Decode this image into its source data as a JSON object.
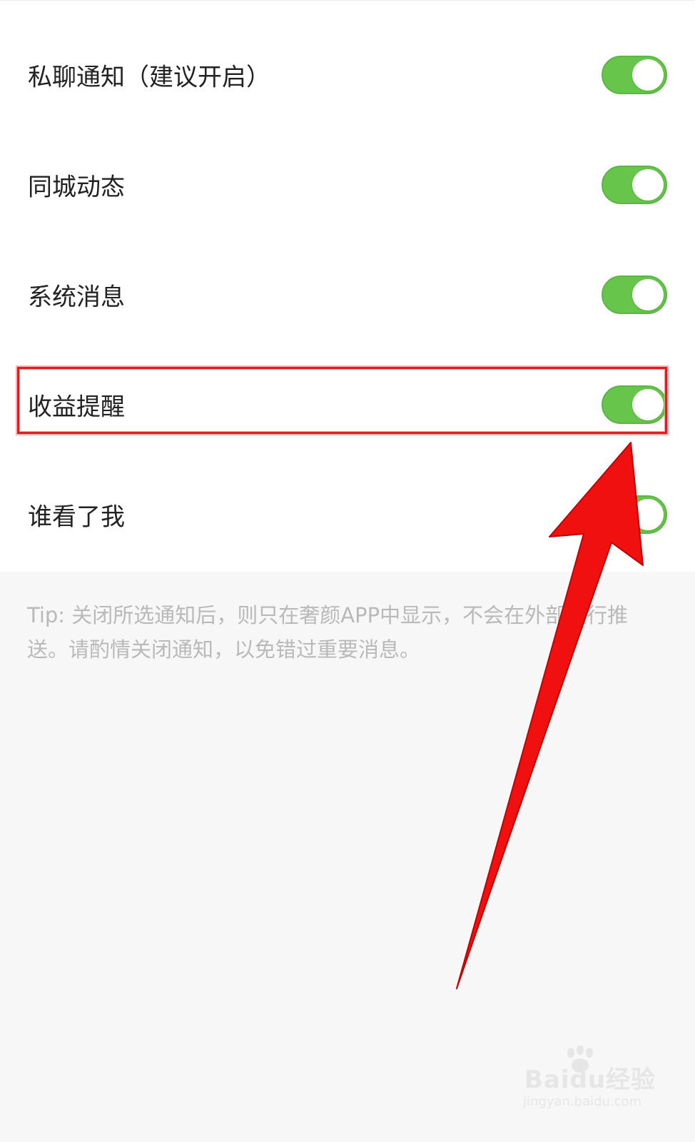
{
  "settings": {
    "items": [
      {
        "label": "私聊通知（建议开启）",
        "enabled": true
      },
      {
        "label": "同城动态",
        "enabled": true
      },
      {
        "label": "系统消息",
        "enabled": true
      },
      {
        "label": "收益提醒",
        "enabled": true
      },
      {
        "label": "谁看了我",
        "enabled": true
      }
    ]
  },
  "tip": {
    "text": "Tip: 关闭所选通知后，则只在奢颜APP中显示，不会在外部进行推送。请酌情关闭通知，以免错过重要消息。"
  },
  "annotation": {
    "highlight_color": "#e01d24",
    "arrow_color": "#f01010"
  },
  "watermark": {
    "brand": "Baidu经验",
    "url": "jingyan.baidu.com"
  },
  "colors": {
    "toggle_on": "#66c54a",
    "page_background": "#f7f7f7",
    "panel_background": "#ffffff",
    "tip_text": "#b9b9b9"
  }
}
